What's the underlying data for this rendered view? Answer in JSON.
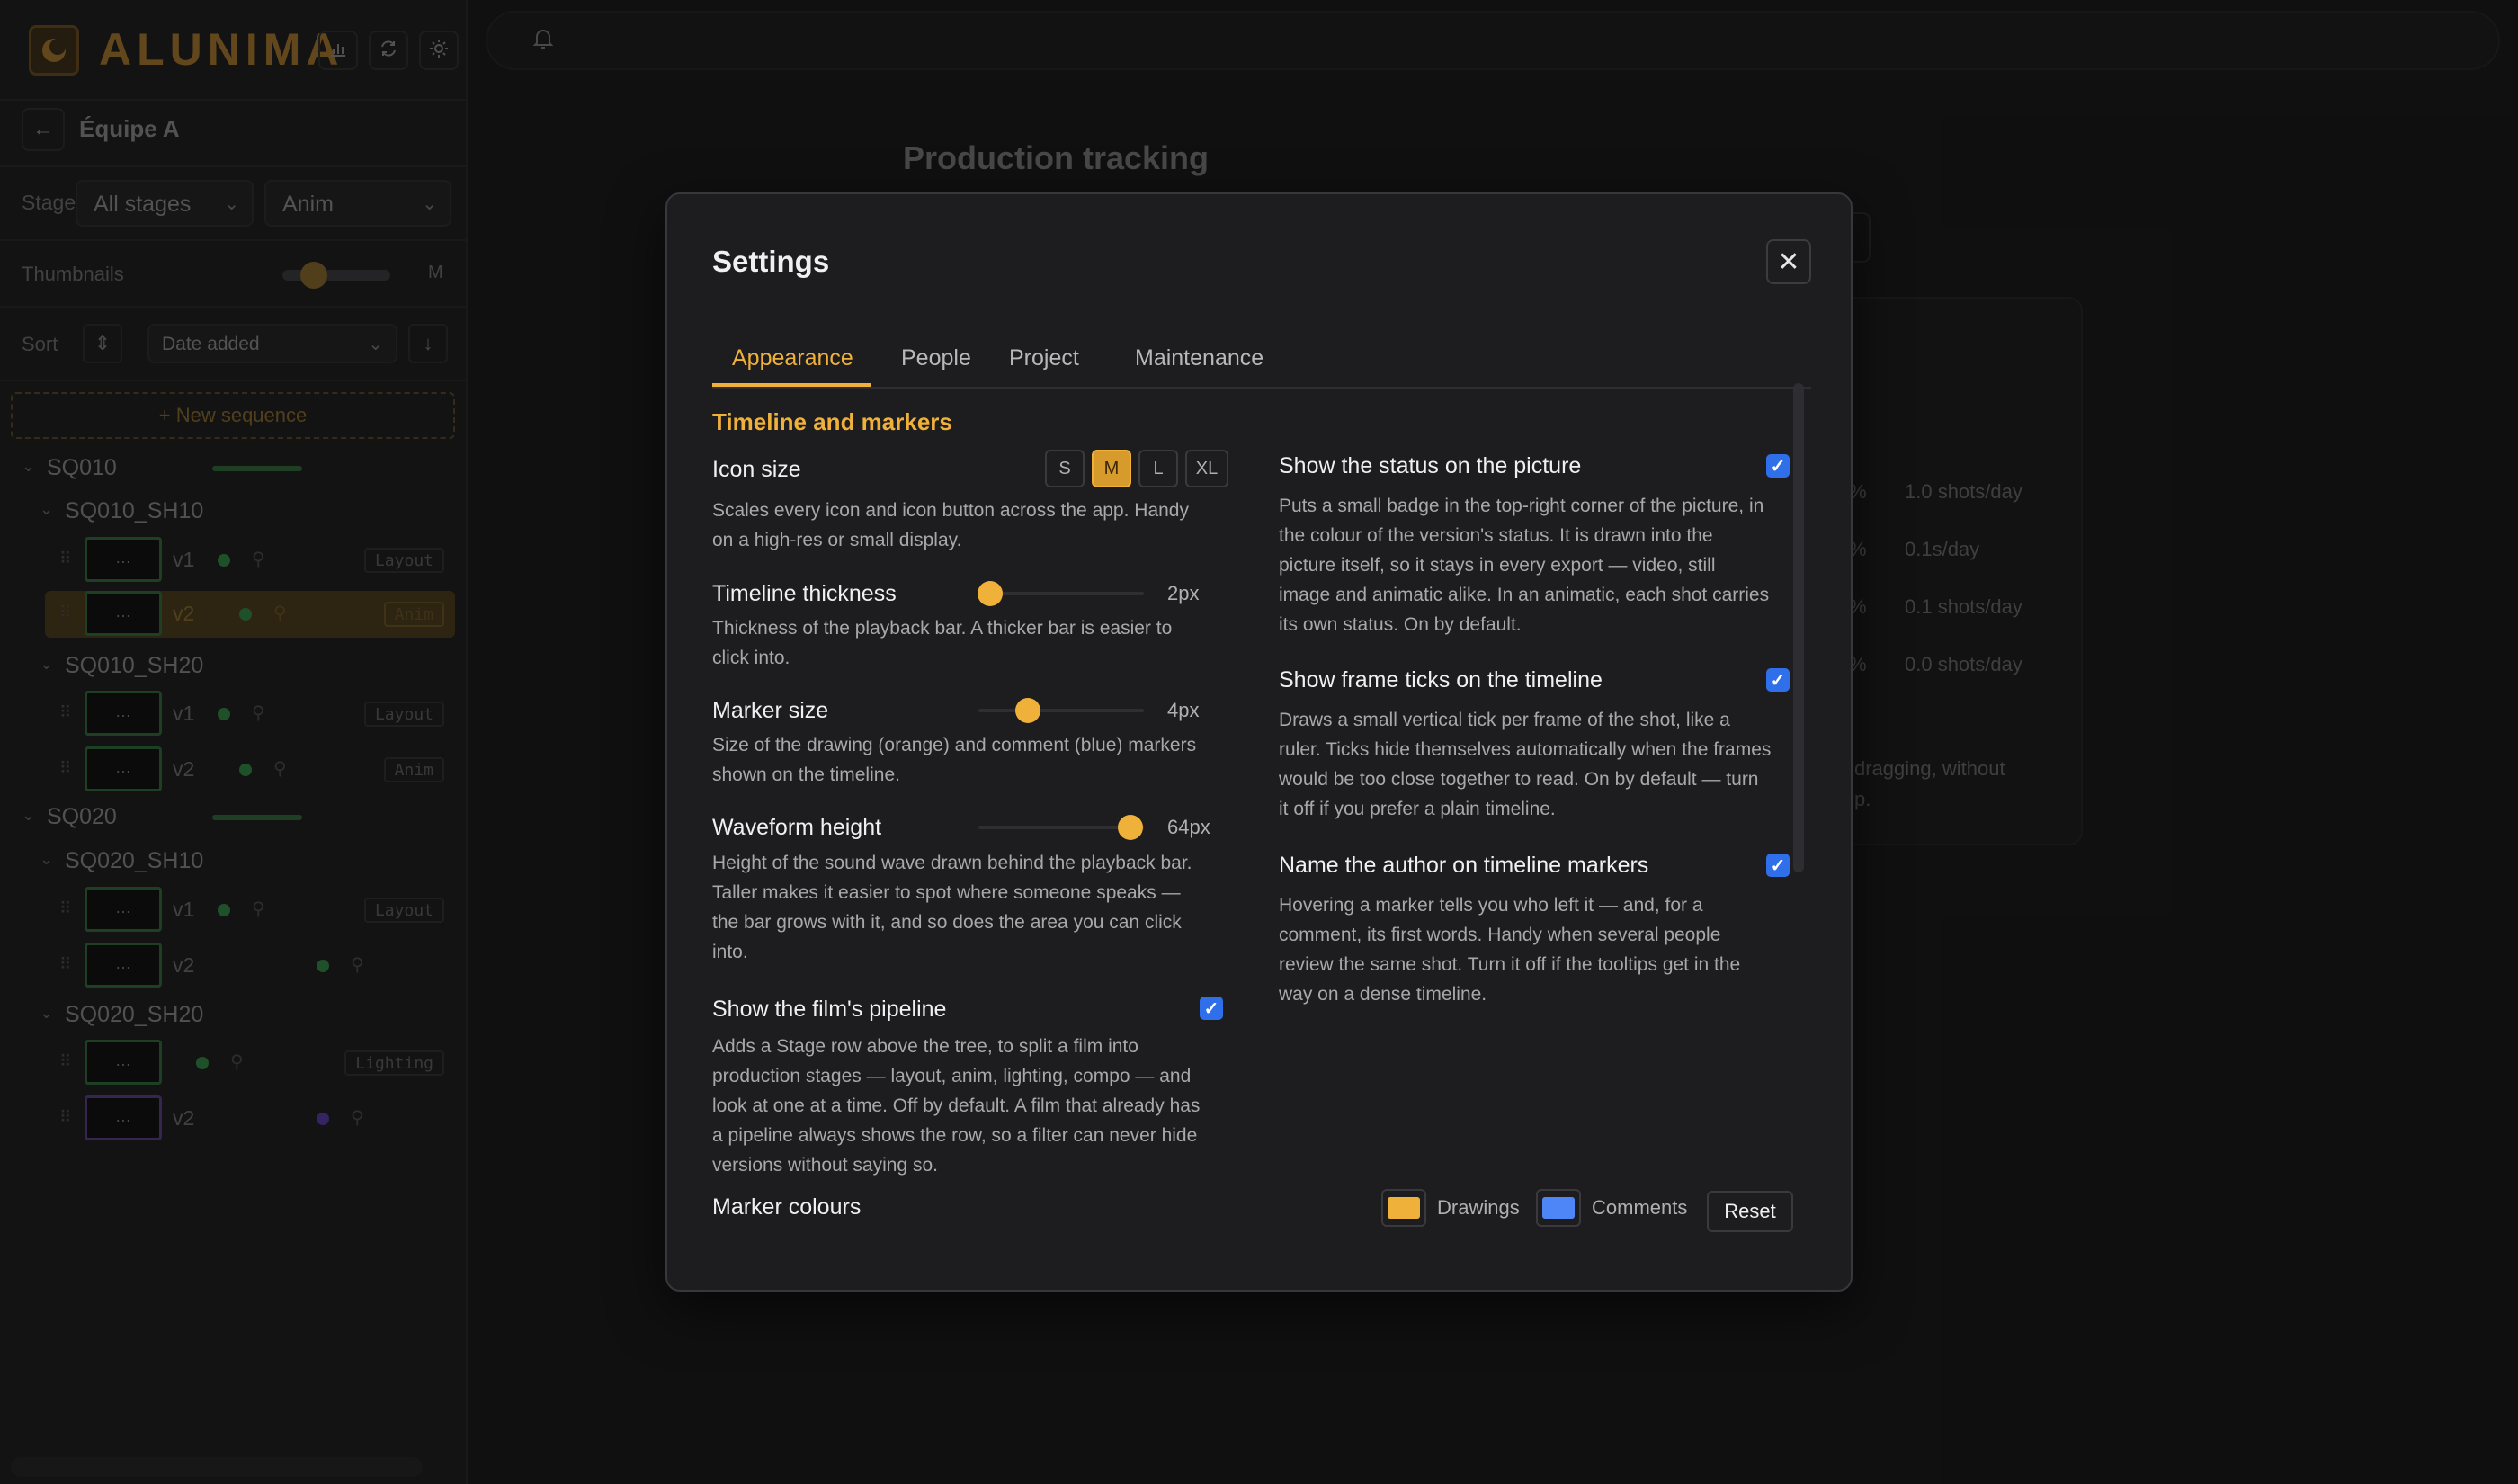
{
  "app": {
    "name": "ALUNIMA"
  },
  "sidebar": {
    "team_name": "Équipe A",
    "stage_label": "Stage",
    "stage_select": "All stages",
    "dept_select": "Anim",
    "thumbnails_label": "Thumbnails",
    "thumbnails_size": "M",
    "sort_label": "Sort",
    "sort_select": "Date added",
    "new_sequence": "+ New sequence",
    "sequences": [
      {
        "name": "SQ010",
        "shots": [
          {
            "name": "SQ010_SH10",
            "versions": [
              {
                "version": "v1",
                "stage": "Layout"
              },
              {
                "version": "v2",
                "stage": "Anim",
                "selected": true
              }
            ]
          },
          {
            "name": "SQ010_SH20",
            "versions": [
              {
                "version": "v1",
                "stage": "Layout"
              },
              {
                "version": "v2",
                "stage": "Anim"
              }
            ]
          }
        ]
      },
      {
        "name": "SQ020",
        "shots": [
          {
            "name": "SQ020_SH10",
            "versions": [
              {
                "version": "v1",
                "stage": "Layout"
              },
              {
                "version": "v2",
                "stage": ""
              }
            ]
          },
          {
            "name": "SQ020_SH20",
            "versions": [
              {
                "version": "v1",
                "stage": "Lighting"
              },
              {
                "version": "v2",
                "stage": ""
              }
            ]
          }
        ]
      }
    ],
    "thumb_placeholder": "…"
  },
  "background": {
    "title": "Production tracking",
    "stats": [
      {
        "pct": "%",
        "rate": "1.0 shots/day"
      },
      {
        "pct": "%",
        "rate": "0.1s/day"
      },
      {
        "pct": "%",
        "rate": "0.1 shots/day"
      },
      {
        "pct": "%",
        "rate": "0.0 shots/day"
      }
    ],
    "note_line1": "dragging, without",
    "note_line2": "p."
  },
  "settings": {
    "title": "Settings",
    "tabs": [
      "Appearance",
      "People",
      "Project",
      "Maintenance"
    ],
    "active_tab": "Appearance",
    "section_title": "Timeline and markers",
    "icon_size": {
      "title": "Icon size",
      "options": [
        "S",
        "M",
        "L",
        "XL"
      ],
      "selected": "M",
      "desc_line1": "Scales every icon and icon button across the app. Handy",
      "desc_line2": "on a high-res or small display."
    },
    "timeline_thickness": {
      "title": "Timeline thickness",
      "value": "2px",
      "fraction": 0.07,
      "desc_line1": "Thickness of the playback bar. A thicker bar is easier to",
      "desc_line2": "click into."
    },
    "marker_size": {
      "title": "Marker size",
      "value": "4px",
      "fraction": 0.3,
      "desc_line1": "Size of the drawing (orange) and comment (blue) markers",
      "desc_line2": "shown on the timeline."
    },
    "waveform_height": {
      "title": "Waveform height",
      "value": "64px",
      "fraction": 0.92,
      "desc_line1": "Height of the sound wave drawn behind the playback bar.",
      "desc_line2": "Taller makes it easier to spot where someone speaks —",
      "desc_line3": "the bar grows with it, and so does the area you can click",
      "desc_line4": "into."
    },
    "pipeline": {
      "title": "Show the film's pipeline",
      "checked": true,
      "desc_line1": "Adds a Stage row above the tree, to split a film into",
      "desc_line2": "production stages — layout, anim, lighting, compo — and",
      "desc_line3": "look at one at a time. Off by default. A film that already has",
      "desc_line4": "a pipeline always shows the row, so a filter can never hide",
      "desc_line5": "versions without saying so."
    },
    "marker_colours": {
      "title": "Marker colours",
      "drawings_label": "Drawings",
      "drawings_color": "#f0b13a",
      "comments_label": "Comments",
      "comments_color": "#4f86f7",
      "reset_label": "Reset"
    },
    "status_on_picture": {
      "title": "Show the status on the picture",
      "checked": true,
      "desc_line1": "Puts a small badge in the top-right corner of the picture, in",
      "desc_line2": "the colour of the version's status. It is drawn into the",
      "desc_line3": "picture itself, so it stays in every export — video, still",
      "desc_line4": "image and animatic alike. In an animatic, each shot carries",
      "desc_line5": "its own status. On by default."
    },
    "frame_ticks": {
      "title": "Show frame ticks on the timeline",
      "checked": true,
      "desc_line1": "Draws a small vertical tick per frame of the shot, like a",
      "desc_line2": "ruler. Ticks hide themselves automatically when the frames",
      "desc_line3": "would be too close together to read. On by default — turn",
      "desc_line4": "it off if you prefer a plain timeline."
    },
    "author_markers": {
      "title": "Name the author on timeline markers",
      "checked": true,
      "desc_line1": "Hovering a marker tells you who left it — and, for a",
      "desc_line2": "comment, its first words. Handy when several people",
      "desc_line3": "review the same shot. Turn it off if the tooltips get in the",
      "desc_line4": "way on a dense timeline."
    }
  },
  "colors": {
    "accent": "#f0b13a",
    "checkbox": "#2f6fea",
    "status_green": "#2f8a44",
    "status_purple": "#5a3aaa"
  }
}
